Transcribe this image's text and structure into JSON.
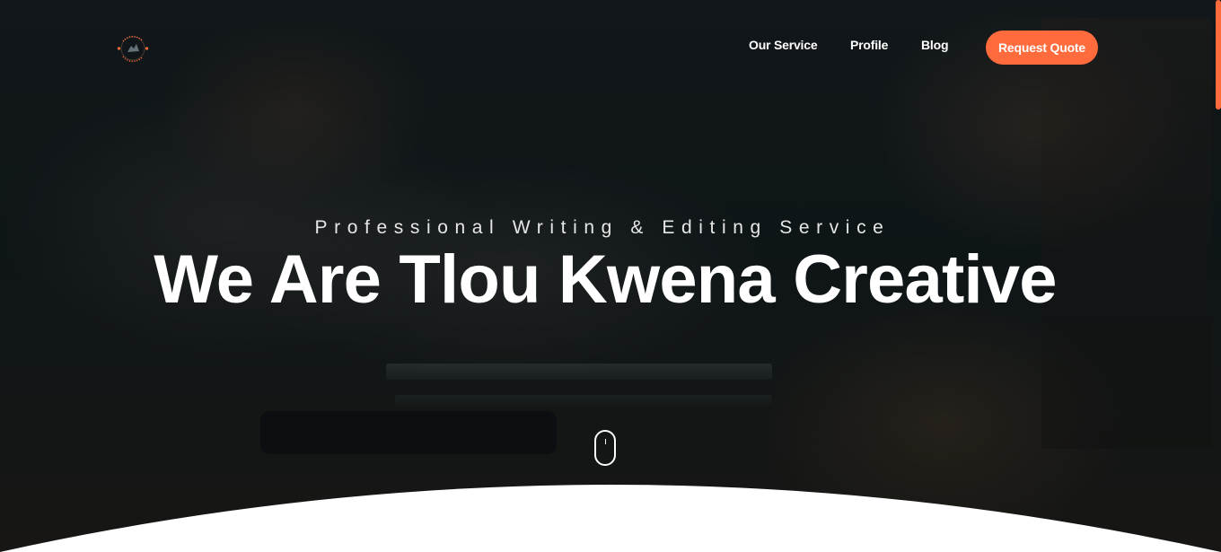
{
  "brand": {
    "logo_icon": "logo-icon",
    "accent_color": "#ff6b3d"
  },
  "nav": {
    "items": [
      {
        "label": "Our Service"
      },
      {
        "label": "Profile"
      },
      {
        "label": "Blog"
      }
    ],
    "cta_label": "Request Quote"
  },
  "hero": {
    "subtitle": "Professional Writing & Editing Service",
    "title": "We Are Tlou Kwena Creative",
    "scroll_icon": "mouse-scroll-icon"
  }
}
